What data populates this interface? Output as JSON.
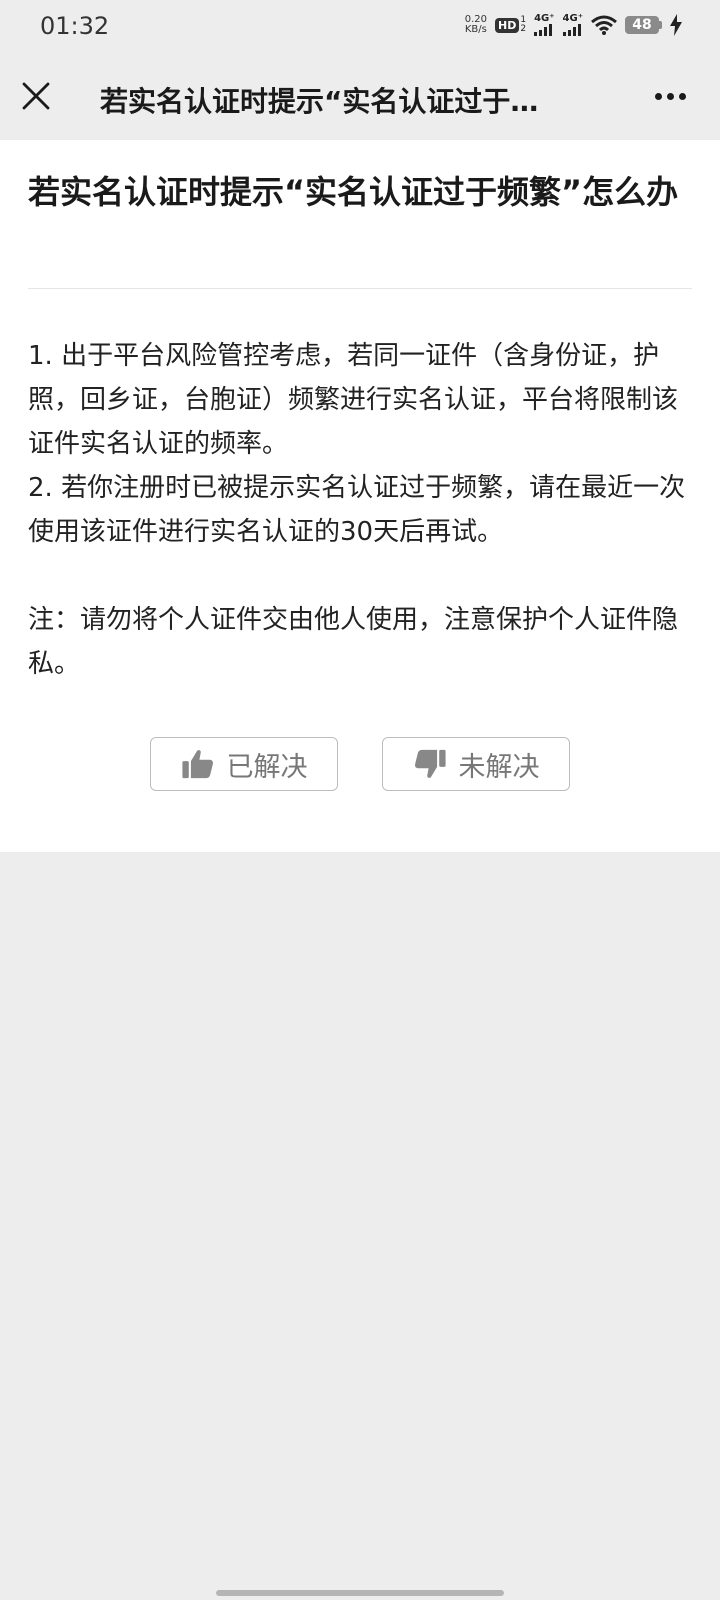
{
  "status_bar": {
    "time": "01:32",
    "net_speed_value": "0.20",
    "net_speed_unit": "KB/s",
    "hd_label": "HD",
    "hd_sim_top": "1",
    "hd_sim_bottom": "2",
    "signal1_label": "4G⁺",
    "signal2_label": "4G⁺",
    "battery_level": "48"
  },
  "nav": {
    "title": "若实名认证时提示“实名认证过于…"
  },
  "article": {
    "title": "若实名认证时提示“实名认证过于频繁”怎么办",
    "paragraph1": "1. 出于平台风险管控考虑，若同一证件（含身份证，护照，回乡证，台胞证）频繁进行实名认证，平台将限制该证件实名认证的频率。",
    "paragraph2": "2. 若你注册时已被提示实名认证过于频繁，请在最近一次使用该证件进行实名认证的30天后再试。",
    "note": "注：请勿将个人证件交由他人使用，注意保护个人证件隐私。"
  },
  "feedback": {
    "resolved_label": "已解决",
    "unresolved_label": "未解决"
  },
  "colors": {
    "page_background": "#ededed",
    "content_background": "#ffffff",
    "icon_gray": "#888888"
  }
}
